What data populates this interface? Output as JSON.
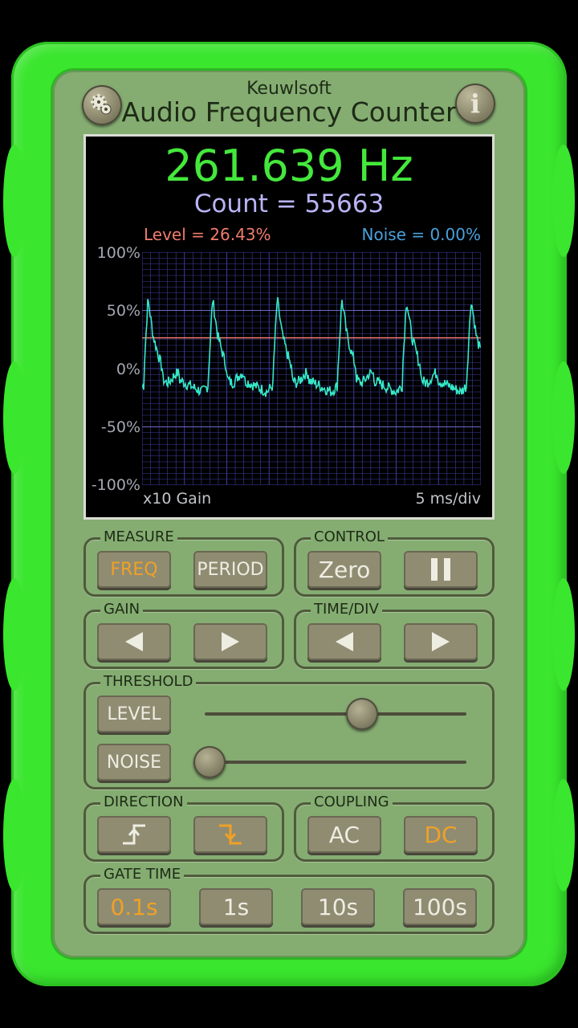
{
  "app": {
    "brand": "Keuwlsoft",
    "title": "Audio Frequency Counter",
    "settings_icon": "gear-icon",
    "info_label": "i"
  },
  "display": {
    "frequency": "261.639 Hz",
    "count": "Count = 55663",
    "level": "Level = 26.43%",
    "noise": "Noise = 0.00%",
    "y_ticks": [
      "100%",
      "50%",
      "0%",
      "-50%",
      "-100%"
    ],
    "gain": "x10 Gain",
    "time_div": "5 ms/div",
    "colors": {
      "frequency": "#44e83c",
      "count": "#b8b4f4",
      "level": "#ef7c6c",
      "noise": "#4aa0dc",
      "trace": "#35e8c8",
      "grid": "#3c3c9c"
    }
  },
  "chart_data": {
    "type": "line",
    "ylim": [
      -100,
      100
    ],
    "y_unit": "%",
    "level_line": 26.43,
    "waveform_period_ms": 3.82,
    "time_per_div_ms": 5,
    "series": [
      {
        "peak": 60,
        "trough": -20,
        "baseline": 0
      }
    ]
  },
  "controls": {
    "measure": {
      "label": "MEASURE",
      "freq": "FREQ",
      "period": "PERIOD",
      "selected": "FREQ"
    },
    "control": {
      "label": "CONTROL",
      "zero": "Zero",
      "pause_icon": "pause-icon"
    },
    "gain": {
      "label": "GAIN"
    },
    "time_div": {
      "label": "TIME/DIV"
    },
    "threshold": {
      "label": "THRESHOLD",
      "level": "LEVEL",
      "noise": "NOISE",
      "level_value": 0.6,
      "noise_value": 0.0
    },
    "direction": {
      "label": "DIRECTION",
      "selected": "falling"
    },
    "coupling": {
      "label": "COUPLING",
      "ac": "AC",
      "dc": "DC",
      "selected": "DC"
    },
    "gate_time": {
      "label": "GATE TIME",
      "options": [
        "0.1s",
        "1s",
        "10s",
        "100s"
      ],
      "selected": "0.1s"
    },
    "accent_color": "#f0a126"
  }
}
